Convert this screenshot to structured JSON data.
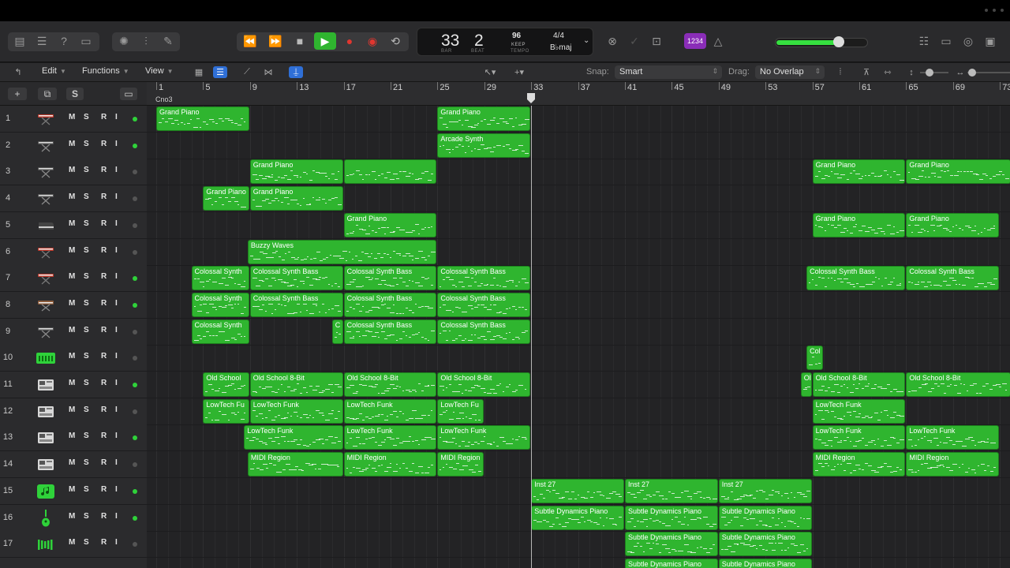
{
  "lcd": {
    "bar": "33",
    "beat": "2",
    "bar_label": "BAR",
    "beat_label": "BEAT",
    "tempo": "96",
    "tempo_mode": "KEEP",
    "tempo_label": "TEMPO",
    "time_sig": "4/4",
    "key": "B♭maj"
  },
  "badge_1234": "1234",
  "volume": {
    "level": 0.68
  },
  "toolbar": {
    "edit": "Edit",
    "functions": "Functions",
    "view": "View",
    "snap_label": "Snap:",
    "snap_value": "Smart",
    "drag_label": "Drag:",
    "drag_value": "No Overlap"
  },
  "header_buttons": {
    "add": "+",
    "dup": "⧉",
    "s": "S"
  },
  "ruler": {
    "marker": "Cno3",
    "labels": [
      "1",
      "5",
      "9",
      "13",
      "17",
      "21",
      "25",
      "29",
      "33",
      "37",
      "41",
      "45",
      "49",
      "53",
      "57",
      "61",
      "65",
      "69",
      "73"
    ],
    "playhead_bar": 33
  },
  "tracks": [
    {
      "num": "1",
      "icon": "keyboard-red-icon",
      "dot": true
    },
    {
      "num": "2",
      "icon": "keyboard-stand-icon",
      "dot": true
    },
    {
      "num": "3",
      "icon": "keyboard-stand-icon",
      "dot": false
    },
    {
      "num": "4",
      "icon": "keyboard-stand-icon",
      "dot": false
    },
    {
      "num": "5",
      "icon": "grand-piano-icon",
      "dot": false
    },
    {
      "num": "6",
      "icon": "keyboard-red-icon",
      "dot": false
    },
    {
      "num": "7",
      "icon": "keyboard-red-icon",
      "dot": true
    },
    {
      "num": "8",
      "icon": "synth-brown-icon",
      "dot": true
    },
    {
      "num": "9",
      "icon": "keyboard-stand-icon",
      "dot": false
    },
    {
      "num": "10",
      "icon": "drum-machine-icon",
      "dot": false
    },
    {
      "num": "11",
      "icon": "sampler-icon",
      "dot": true
    },
    {
      "num": "12",
      "icon": "sampler-icon",
      "dot": false
    },
    {
      "num": "13",
      "icon": "sampler-icon",
      "dot": true
    },
    {
      "num": "14",
      "icon": "sampler-icon",
      "dot": false
    },
    {
      "num": "15",
      "icon": "music-note-icon",
      "dot": true
    },
    {
      "num": "16",
      "icon": "guitar-icon",
      "dot": true
    },
    {
      "num": "17",
      "icon": "vibraphone-icon",
      "dot": false
    }
  ],
  "msri": [
    "M",
    "S",
    "R",
    "I"
  ],
  "regions": [
    {
      "track": 1,
      "start": 1,
      "end": 9,
      "name": "Grand Piano"
    },
    {
      "track": 1,
      "start": 25,
      "end": 33,
      "name": "Grand Piano"
    },
    {
      "track": 2,
      "start": 25,
      "end": 33,
      "name": "Arcade Synth"
    },
    {
      "track": 3,
      "start": 9,
      "end": 17,
      "name": "Grand Piano"
    },
    {
      "track": 3,
      "start": 17,
      "end": 25,
      "name": ""
    },
    {
      "track": 3,
      "start": 57,
      "end": 65,
      "name": "Grand Piano"
    },
    {
      "track": 3,
      "start": 65,
      "end": 74,
      "name": "Grand Piano"
    },
    {
      "track": 4,
      "start": 5,
      "end": 9,
      "name": "Grand Piano"
    },
    {
      "track": 4,
      "start": 9,
      "end": 17,
      "name": "Grand Piano"
    },
    {
      "track": 5,
      "start": 17,
      "end": 25,
      "name": "Grand Piano"
    },
    {
      "track": 5,
      "start": 57,
      "end": 65,
      "name": "Grand Piano"
    },
    {
      "track": 5,
      "start": 65,
      "end": 73,
      "name": "Grand Piano"
    },
    {
      "track": 6,
      "start": 8.8,
      "end": 25,
      "name": "Buzzy Waves"
    },
    {
      "track": 7,
      "start": 4,
      "end": 9,
      "name": "Colossal Synth"
    },
    {
      "track": 7,
      "start": 9,
      "end": 17,
      "name": "Colossal Synth Bass"
    },
    {
      "track": 7,
      "start": 17,
      "end": 25,
      "name": "Colossal Synth Bass"
    },
    {
      "track": 7,
      "start": 25,
      "end": 33,
      "name": "Colossal Synth Bass"
    },
    {
      "track": 7,
      "start": 56.5,
      "end": 65,
      "name": "Colossal Synth Bass"
    },
    {
      "track": 7,
      "start": 65,
      "end": 73,
      "name": "Colossal Synth Bass"
    },
    {
      "track": 8,
      "start": 4,
      "end": 9,
      "name": "Colossal Synth"
    },
    {
      "track": 8,
      "start": 9,
      "end": 17,
      "name": "Colossal Synth Bass"
    },
    {
      "track": 8,
      "start": 17,
      "end": 25,
      "name": "Colossal Synth Bass"
    },
    {
      "track": 8,
      "start": 25,
      "end": 33,
      "name": "Colossal Synth Bass"
    },
    {
      "track": 9,
      "start": 4,
      "end": 9,
      "name": "Colossal Synth"
    },
    {
      "track": 9,
      "start": 16,
      "end": 17,
      "name": "C"
    },
    {
      "track": 9,
      "start": 17,
      "end": 25,
      "name": "Colossal Synth Bass"
    },
    {
      "track": 9,
      "start": 25,
      "end": 33,
      "name": "Colossal Synth Bass"
    },
    {
      "track": 10,
      "start": 56.5,
      "end": 58,
      "name": "Col"
    },
    {
      "track": 11,
      "start": 5,
      "end": 9,
      "name": "Old School"
    },
    {
      "track": 11,
      "start": 9,
      "end": 17,
      "name": "Old School 8-Bit"
    },
    {
      "track": 11,
      "start": 17,
      "end": 25,
      "name": "Old School 8-Bit"
    },
    {
      "track": 11,
      "start": 25,
      "end": 33,
      "name": "Old School 8-Bit"
    },
    {
      "track": 11,
      "start": 56,
      "end": 57,
      "name": "Ol"
    },
    {
      "track": 11,
      "start": 57,
      "end": 65,
      "name": "Old School 8-Bit"
    },
    {
      "track": 11,
      "start": 65,
      "end": 74,
      "name": "Old School 8-Bit"
    },
    {
      "track": 12,
      "start": 5,
      "end": 9,
      "name": "LowTech Fu"
    },
    {
      "track": 12,
      "start": 9,
      "end": 17,
      "name": "LowTech Funk"
    },
    {
      "track": 12,
      "start": 17,
      "end": 25,
      "name": "LowTech Funk"
    },
    {
      "track": 12,
      "start": 25,
      "end": 29,
      "name": "LowTech Fu"
    },
    {
      "track": 12,
      "start": 57,
      "end": 65,
      "name": "LowTech Funk"
    },
    {
      "track": 13,
      "start": 8.5,
      "end": 17,
      "name": "LowTech Funk"
    },
    {
      "track": 13,
      "start": 17,
      "end": 25,
      "name": "LowTech Funk"
    },
    {
      "track": 13,
      "start": 25,
      "end": 33,
      "name": "LowTech Funk"
    },
    {
      "track": 13,
      "start": 57,
      "end": 65,
      "name": "LowTech Funk"
    },
    {
      "track": 13,
      "start": 65,
      "end": 73,
      "name": "LowTech Funk"
    },
    {
      "track": 14,
      "start": 8.8,
      "end": 17,
      "name": "MIDI Region"
    },
    {
      "track": 14,
      "start": 17,
      "end": 25,
      "name": "MIDI Region"
    },
    {
      "track": 14,
      "start": 25,
      "end": 29,
      "name": "MIDI Region"
    },
    {
      "track": 14,
      "start": 57,
      "end": 65,
      "name": "MIDI Region"
    },
    {
      "track": 14,
      "start": 65,
      "end": 73,
      "name": "MIDI Region"
    },
    {
      "track": 15,
      "start": 33,
      "end": 41,
      "name": "Inst 27"
    },
    {
      "track": 15,
      "start": 41,
      "end": 49,
      "name": "Inst 27"
    },
    {
      "track": 15,
      "start": 49,
      "end": 57,
      "name": "Inst 27"
    },
    {
      "track": 16,
      "start": 33,
      "end": 41,
      "name": "Subtle Dynamics Piano"
    },
    {
      "track": 16,
      "start": 41,
      "end": 49,
      "name": "Subtle Dynamics Piano"
    },
    {
      "track": 16,
      "start": 49,
      "end": 57,
      "name": "Subtle Dynamics Piano"
    },
    {
      "track": 17,
      "start": 41,
      "end": 49,
      "name": "Subtle Dynamics Piano"
    },
    {
      "track": 17,
      "start": 49,
      "end": 57,
      "name": "Subtle Dynamics Piano"
    },
    {
      "track": 18,
      "start": 41,
      "end": 49,
      "name": "Subtle Dynamics Piano"
    },
    {
      "track": 18,
      "start": 49,
      "end": 57,
      "name": "Subtle Dynamics Piano"
    }
  ]
}
